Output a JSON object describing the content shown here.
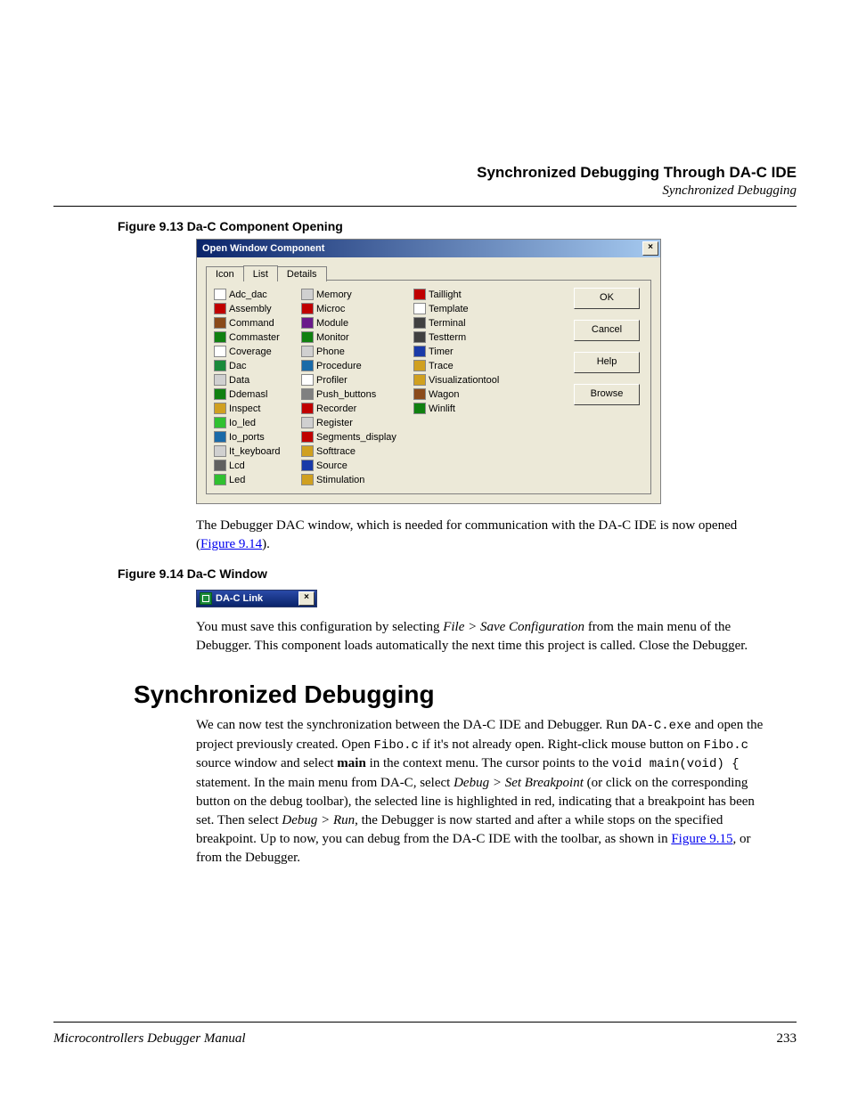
{
  "header": {
    "chapter": "Synchronized Debugging Through DA-C IDE",
    "section": "Synchronized Debugging"
  },
  "fig913_caption": "Figure 9.13  Da-C Component Opening",
  "dialog": {
    "title": "Open Window Component",
    "tabs": {
      "icon": "Icon",
      "list": "List",
      "details": "Details"
    },
    "buttons": {
      "ok": "OK",
      "cancel": "Cancel",
      "help": "Help",
      "browse": "Browse"
    },
    "col1": [
      "Adc_dac",
      "Assembly",
      "Command",
      "Commaster",
      "Coverage",
      "Dac",
      "Data",
      "Ddemasl",
      "Inspect",
      "Io_led",
      "Io_ports",
      "It_keyboard",
      "Lcd",
      "Led"
    ],
    "col2": [
      "Memory",
      "Microc",
      "Module",
      "Monitor",
      "Phone",
      "Procedure",
      "Profiler",
      "Push_buttons",
      "Recorder",
      "Register",
      "Segments_display",
      "Softtrace",
      "Source",
      "Stimulation"
    ],
    "col3": [
      "Taillight",
      "Template",
      "Terminal",
      "Testterm",
      "Timer",
      "Trace",
      "Visualizationtool",
      "Wagon",
      "Winlift"
    ]
  },
  "para1a": "The Debugger DAC window, which is needed for communication with the DA-C IDE is now opened (",
  "para1_link": "Figure 9.14",
  "para1b": ").",
  "fig914_caption": "Figure 9.14  Da-C Window",
  "mini_window_title": "DA-C Link",
  "para2a": "You must save this configuration by selecting ",
  "para2b": "File > Save Configuration",
  "para2c": " from the main menu of the Debugger. This component loads automatically the next time this project is called. Close the Debugger.",
  "h1": "Synchronized Debugging",
  "para3": {
    "t1": "We can now test the synchronization between the DA-C IDE and Debugger. Run ",
    "c1": "DA-C.exe",
    "t2": " and open the project previously created. Open ",
    "c2": "Fibo.c",
    "t3": " if it's not already open. Right-click mouse button on ",
    "c3": "Fibo.c",
    "t4": " source window and select ",
    "b1": "main",
    "t5": " in the context menu. The cursor points to the ",
    "c4": "void main(void) {",
    "t6": " statement. In the main menu from DA-C, select ",
    "i1": "Debug > Set Breakpoint",
    "t7": " (or click on the corresponding button on the debug toolbar), the selected line is highlighted in red, indicating that a breakpoint has been set. Then select ",
    "i2": "Debug > Run",
    "t8": ", the Debugger is now started and after a while stops on the specified breakpoint. Up to now, you can debug from the DA-C IDE with the toolbar, as shown in ",
    "link": "Figure 9.15",
    "t9": ", or from the Debugger."
  },
  "footer": {
    "book": "Microcontrollers Debugger Manual",
    "page": "233"
  }
}
